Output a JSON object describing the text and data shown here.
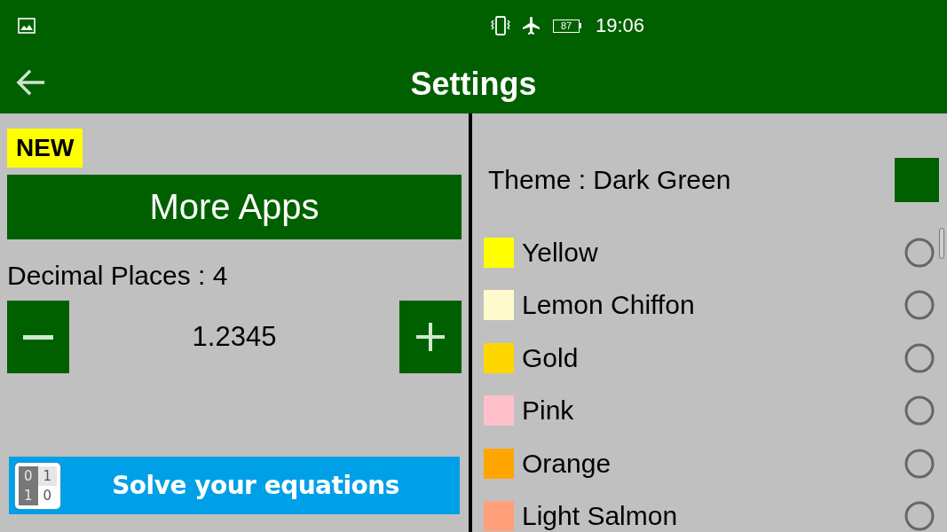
{
  "status_bar": {
    "battery": "87",
    "time": "19:06"
  },
  "toolbar": {
    "title": "Settings"
  },
  "left_panel": {
    "badge": "NEW",
    "more_apps_button": "More Apps",
    "decimal_places": {
      "label": "Decimal Places : 4",
      "value": "1.2345"
    },
    "banner": {
      "logo_digits": [
        "0",
        "1",
        "1",
        "0"
      ],
      "text": "Solve your equations"
    }
  },
  "theme": {
    "label": "Theme : Dark Green",
    "color": "#006000"
  },
  "colors": [
    {
      "name": "Yellow",
      "color": "#ffff00",
      "selected": false
    },
    {
      "name": "Lemon Chiffon",
      "color": "#fffacd",
      "selected": false
    },
    {
      "name": "Gold",
      "color": "#ffd700",
      "selected": false
    },
    {
      "name": "Pink",
      "color": "#ffc0cb",
      "selected": false
    },
    {
      "name": "Orange",
      "color": "#ffa500",
      "selected": false
    },
    {
      "name": "Light Salmon",
      "color": "#ffa07a",
      "selected": false
    }
  ]
}
